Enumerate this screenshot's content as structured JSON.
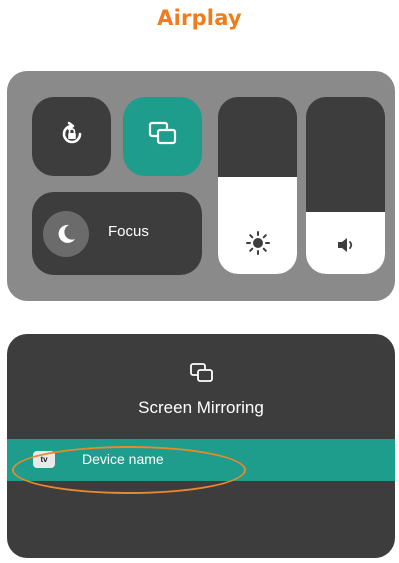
{
  "page": {
    "title": "Airplay",
    "title_color": "#f07d1a"
  },
  "control_center": {
    "panel_color": "#8a8a8a",
    "tile_color": "#3d3d3d",
    "accent_color": "#1e9c8c",
    "rotation_lock": {
      "icon": "rotation-lock-icon"
    },
    "screen_mirroring": {
      "icon": "screen-mirroring-icon",
      "active": true
    },
    "focus": {
      "label": "Focus",
      "icon": "moon-icon"
    },
    "brightness": {
      "icon": "sun-icon",
      "level": 0.55
    },
    "volume": {
      "icon": "speaker-icon",
      "level": 0.35
    }
  },
  "mirroring_sheet": {
    "title": "Screen Mirroring",
    "icon": "screen-mirroring-icon",
    "devices": [
      {
        "name": "Device name",
        "icon_label": "tv",
        "icon": "apple-tv-icon",
        "selected": true
      }
    ],
    "highlight_color": "#e8892e"
  }
}
